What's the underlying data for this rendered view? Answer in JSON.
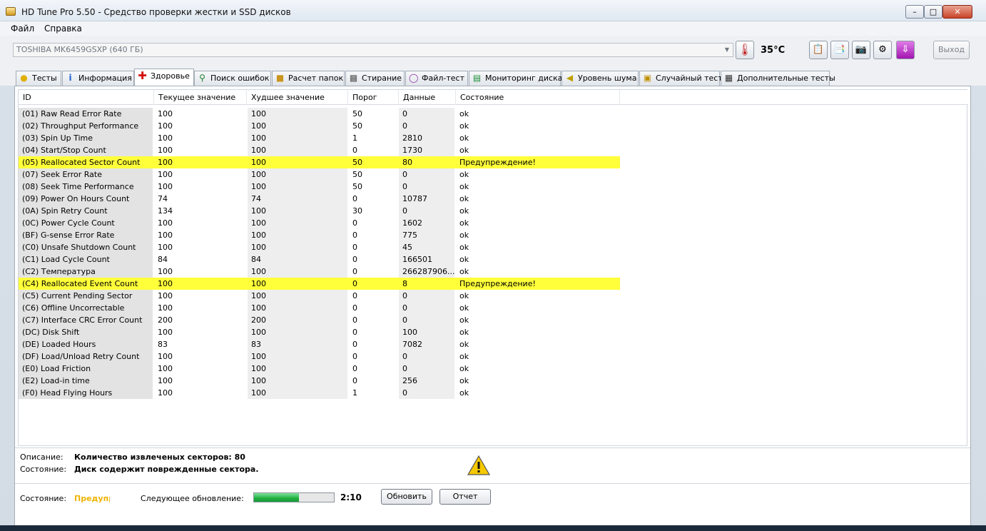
{
  "window": {
    "title": "HD Tune Pro 5.50 - Средство проверки жестки и SSD дисков"
  },
  "menu": {
    "file": "Файл",
    "help": "Справка"
  },
  "drive": {
    "selected": "TOSHIBA MK6459GSXP (640 ГБ)",
    "temperature": "35°C",
    "exit_label": "Выход"
  },
  "tabs": [
    {
      "label": "Тесты",
      "icon": "bulb-icon"
    },
    {
      "label": "Информация",
      "icon": "info-icon"
    },
    {
      "label": "Здоровье",
      "icon": "health-cross-icon"
    },
    {
      "label": "Поиск ошибок",
      "icon": "magnifier-icon"
    },
    {
      "label": "Расчет папок",
      "icon": "folder-icon"
    },
    {
      "label": "Стирание",
      "icon": "eraser-icon"
    },
    {
      "label": "Файл-тест",
      "icon": "file-test-icon"
    },
    {
      "label": "Мониторинг диска",
      "icon": "monitor-chart-icon"
    },
    {
      "label": "Уровень шума",
      "icon": "speaker-icon"
    },
    {
      "label": "Случайный тест",
      "icon": "random-icon"
    },
    {
      "label": "Дополнительные тесты",
      "icon": "extra-tests-icon"
    }
  ],
  "columns": {
    "id": "ID",
    "current": "Текущее значение",
    "worst": "Худшее значение",
    "threshold": "Порог",
    "data": "Данные",
    "status": "Состояние"
  },
  "rows": [
    {
      "id": "(01) Raw Read Error Rate",
      "current": "100",
      "worst": "100",
      "threshold": "50",
      "data": "0",
      "status": "ok",
      "warn": false
    },
    {
      "id": "(02) Throughput Performance",
      "current": "100",
      "worst": "100",
      "threshold": "50",
      "data": "0",
      "status": "ok",
      "warn": false
    },
    {
      "id": "(03) Spin Up Time",
      "current": "100",
      "worst": "100",
      "threshold": "1",
      "data": "2810",
      "status": "ok",
      "warn": false
    },
    {
      "id": "(04) Start/Stop Count",
      "current": "100",
      "worst": "100",
      "threshold": "0",
      "data": "1730",
      "status": "ok",
      "warn": false
    },
    {
      "id": "(05) Reallocated Sector Count",
      "current": "100",
      "worst": "100",
      "threshold": "50",
      "data": "80",
      "status": "Предупреждение!",
      "warn": true
    },
    {
      "id": "(07) Seek Error Rate",
      "current": "100",
      "worst": "100",
      "threshold": "50",
      "data": "0",
      "status": "ok",
      "warn": false
    },
    {
      "id": "(08) Seek Time Performance",
      "current": "100",
      "worst": "100",
      "threshold": "50",
      "data": "0",
      "status": "ok",
      "warn": false
    },
    {
      "id": "(09) Power On Hours Count",
      "current": "74",
      "worst": "74",
      "threshold": "0",
      "data": "10787",
      "status": "ok",
      "warn": false
    },
    {
      "id": "(0A) Spin Retry Count",
      "current": "134",
      "worst": "100",
      "threshold": "30",
      "data": "0",
      "status": "ok",
      "warn": false
    },
    {
      "id": "(0C) Power Cycle Count",
      "current": "100",
      "worst": "100",
      "threshold": "0",
      "data": "1602",
      "status": "ok",
      "warn": false
    },
    {
      "id": "(BF) G-sense Error Rate",
      "current": "100",
      "worst": "100",
      "threshold": "0",
      "data": "775",
      "status": "ok",
      "warn": false
    },
    {
      "id": "(C0) Unsafe Shutdown Count",
      "current": "100",
      "worst": "100",
      "threshold": "0",
      "data": "45",
      "status": "ok",
      "warn": false
    },
    {
      "id": "(C1) Load Cycle Count",
      "current": "84",
      "worst": "84",
      "threshold": "0",
      "data": "166501",
      "status": "ok",
      "warn": false
    },
    {
      "id": "(C2) Температура",
      "current": "100",
      "worst": "100",
      "threshold": "0",
      "data": "266287906...",
      "status": "ok",
      "warn": false
    },
    {
      "id": "(C4) Reallocated Event Count",
      "current": "100",
      "worst": "100",
      "threshold": "0",
      "data": "8",
      "status": "Предупреждение!",
      "warn": true
    },
    {
      "id": "(C5) Current Pending Sector",
      "current": "100",
      "worst": "100",
      "threshold": "0",
      "data": "0",
      "status": "ok",
      "warn": false
    },
    {
      "id": "(C6) Offline Uncorrectable",
      "current": "100",
      "worst": "100",
      "threshold": "0",
      "data": "0",
      "status": "ok",
      "warn": false
    },
    {
      "id": "(C7) Interface CRC Error Count",
      "current": "200",
      "worst": "200",
      "threshold": "0",
      "data": "0",
      "status": "ok",
      "warn": false
    },
    {
      "id": "(DC) Disk Shift",
      "current": "100",
      "worst": "100",
      "threshold": "0",
      "data": "100",
      "status": "ok",
      "warn": false
    },
    {
      "id": "(DE) Loaded Hours",
      "current": "83",
      "worst": "83",
      "threshold": "0",
      "data": "7082",
      "status": "ok",
      "warn": false
    },
    {
      "id": "(DF) Load/Unload Retry Count",
      "current": "100",
      "worst": "100",
      "threshold": "0",
      "data": "0",
      "status": "ok",
      "warn": false
    },
    {
      "id": "(E0) Load Friction",
      "current": "100",
      "worst": "100",
      "threshold": "0",
      "data": "0",
      "status": "ok",
      "warn": false
    },
    {
      "id": "(E2) Load-in time",
      "current": "100",
      "worst": "100",
      "threshold": "0",
      "data": "256",
      "status": "ok",
      "warn": false
    },
    {
      "id": "(F0) Head Flying Hours",
      "current": "100",
      "worst": "100",
      "threshold": "1",
      "data": "0",
      "status": "ok",
      "warn": false
    }
  ],
  "description": {
    "desc_label": "Описание:",
    "desc_value": "Количество извлеченых секторов: 80",
    "state_label": "Состояние:",
    "state_value": "Диск содержит поврежденные сектора."
  },
  "status": {
    "label": "Состояние:",
    "value": "Предупреждение!",
    "next_update_label": "Следующее обновление:",
    "progress": 0.56,
    "time": "2:10",
    "refresh_label": "Обновить",
    "report_label": "Отчет",
    "warn_color": "#f0b400"
  }
}
